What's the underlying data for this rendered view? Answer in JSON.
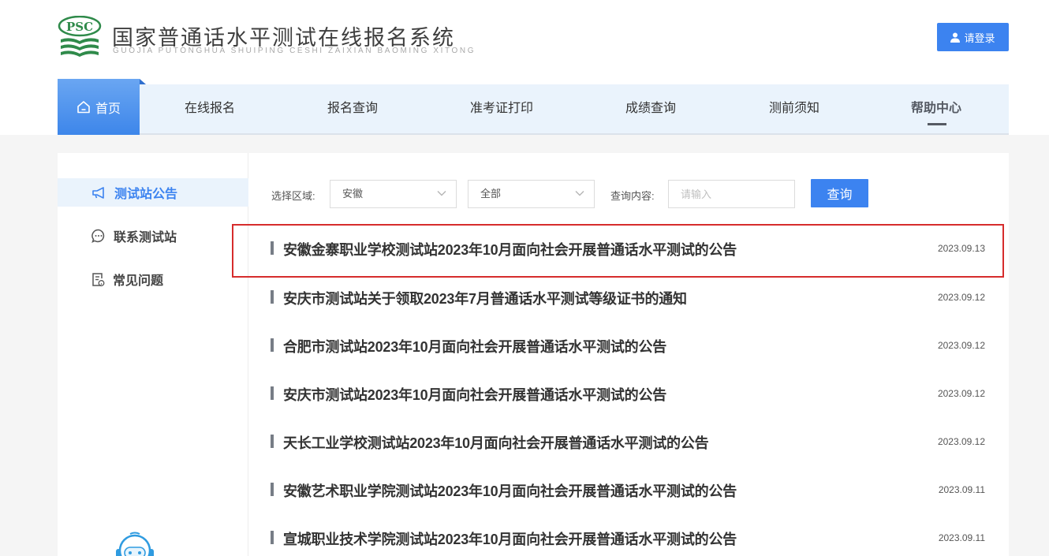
{
  "header": {
    "logo_text": "PSC",
    "title": "国家普通话水平测试在线报名系统",
    "subtitle": "GUOJIA PUTONGHUA SHUIPING CESHI ZAIXIAN BAOMING XITONG",
    "login_label": "请登录",
    "brand_color": "#3c83f0"
  },
  "nav": {
    "home": "首页",
    "items": [
      "在线报名",
      "报名查询",
      "准考证打印",
      "成绩查询",
      "测前须知",
      "帮助中心"
    ],
    "active": "帮助中心"
  },
  "sidebar": {
    "items": [
      {
        "label": "测试站公告",
        "icon": "megaphone-icon",
        "active": true
      },
      {
        "label": "联系测试站",
        "icon": "chat-bubble-icon",
        "active": false
      },
      {
        "label": "常见问题",
        "icon": "document-question-icon",
        "active": false
      }
    ]
  },
  "filter": {
    "region_label": "选择区域:",
    "province": "安徽",
    "city": "全部",
    "query_label": "查询内容:",
    "query_placeholder": "请输入",
    "query_button": "查询"
  },
  "notices": [
    {
      "title": "安徽金寨职业学校测试站2023年10月面向社会开展普通话水平测试的公告",
      "date": "2023.09.13",
      "highlighted": true
    },
    {
      "title": "安庆市测试站关于领取2023年7月普通话水平测试等级证书的通知",
      "date": "2023.09.12"
    },
    {
      "title": "合肥市测试站2023年10月面向社会开展普通话水平测试的公告",
      "date": "2023.09.12"
    },
    {
      "title": "安庆市测试站2023年10月面向社会开展普通话水平测试的公告",
      "date": "2023.09.12"
    },
    {
      "title": "天长工业学校测试站2023年10月面向社会开展普通话水平测试的公告",
      "date": "2023.09.12"
    },
    {
      "title": "安徽艺术职业学院测试站2023年10月面向社会开展普通话水平测试的公告",
      "date": "2023.09.11"
    },
    {
      "title": "宣城职业技术学院测试站2023年10月面向社会开展普通话水平测试的公告",
      "date": "2023.09.11"
    }
  ]
}
